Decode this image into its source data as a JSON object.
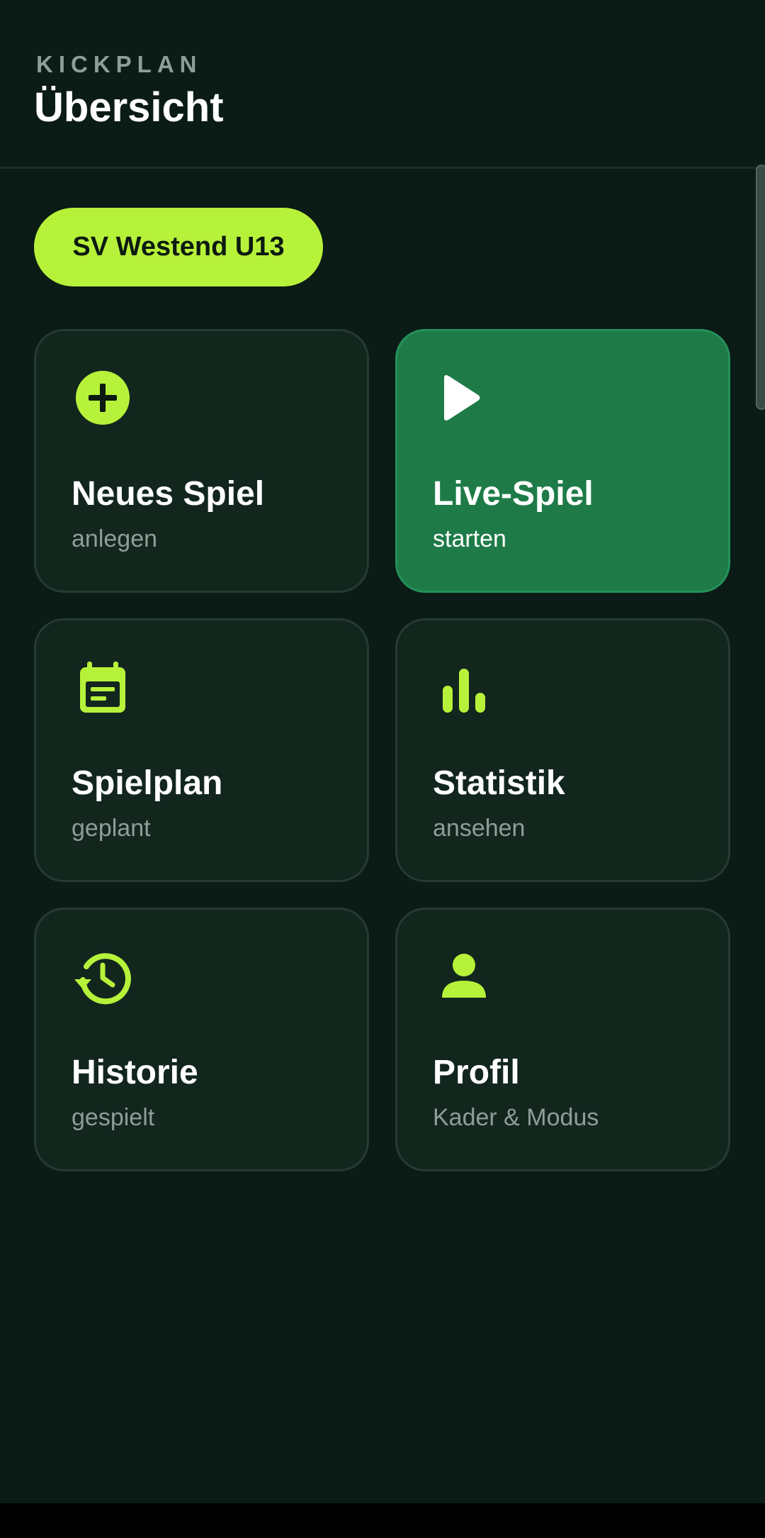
{
  "header": {
    "brand": "KICKPLAN",
    "title": "Übersicht"
  },
  "team_chip": {
    "label": "SV Westend U13"
  },
  "cards": [
    {
      "title": "Neues Spiel",
      "subtitle": "anlegen",
      "icon": "plus-circle-icon"
    },
    {
      "title": "Live-Spiel",
      "subtitle": "starten",
      "icon": "play-icon"
    },
    {
      "title": "Spielplan",
      "subtitle": "geplant",
      "icon": "calendar-icon"
    },
    {
      "title": "Statistik",
      "subtitle": "ansehen",
      "icon": "bar-chart-icon"
    },
    {
      "title": "Historie",
      "subtitle": "gespielt",
      "icon": "history-icon"
    },
    {
      "title": "Profil",
      "subtitle": "Kader & Modus",
      "icon": "person-icon"
    }
  ],
  "colors": {
    "background": "#0b1b16",
    "accent": "#b7f23a",
    "card": "#12261e",
    "card_active": "#1e7b48",
    "muted_text": "#8e9e97"
  }
}
